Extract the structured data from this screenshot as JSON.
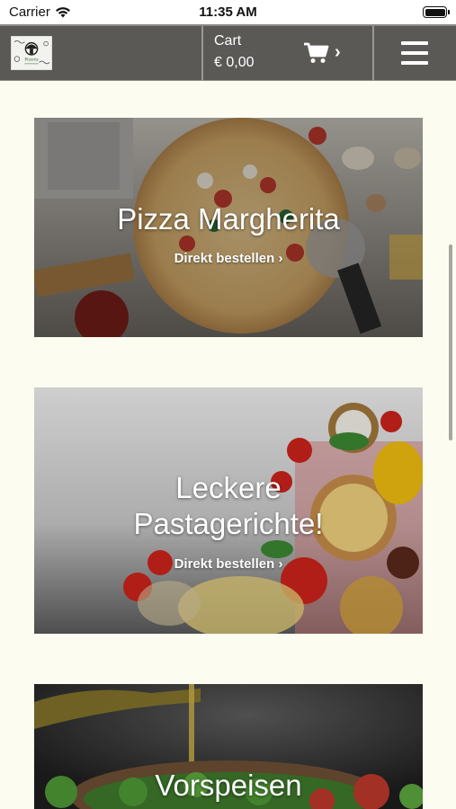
{
  "status_bar": {
    "carrier": "Carrier",
    "time": "11:35 AM"
  },
  "header": {
    "logo_text": "Pizzeria",
    "cart_label": "Cart",
    "cart_total": "€ 0,00",
    "cart_chevron": "›"
  },
  "cards": [
    {
      "title": "Pizza Margherita",
      "link": "Direkt bestellen ›"
    },
    {
      "title": "Leckere\nPastagerichte!",
      "link": "Direkt bestellen ›"
    },
    {
      "title": "Vorspeisen"
    }
  ],
  "icons": {
    "wifi": "wifi-icon",
    "battery": "battery-icon",
    "cart": "shopping-cart-icon",
    "menu": "hamburger-menu-icon"
  },
  "colors": {
    "header_bg": "#5a5956",
    "page_bg": "#fdfcf1"
  }
}
